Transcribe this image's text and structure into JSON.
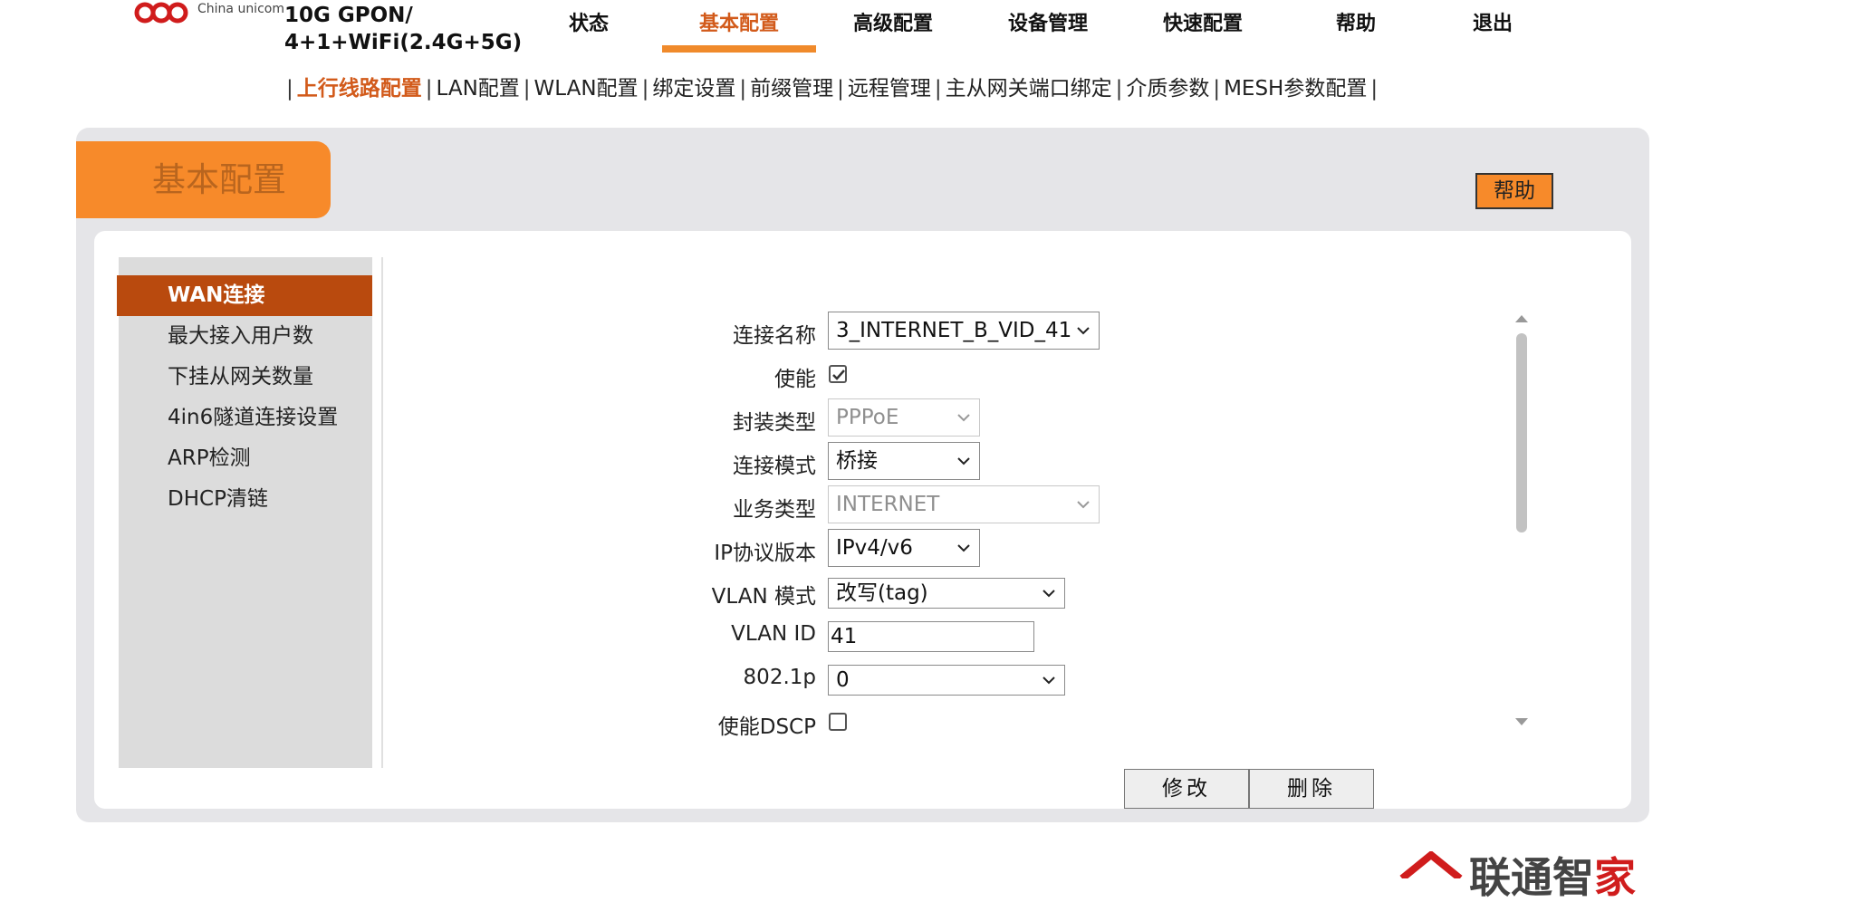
{
  "header": {
    "logo_text": "China unicom",
    "product_line1": "10G GPON/",
    "product_line2": "4+1+WiFi(2.4G+5G)",
    "nav": [
      {
        "label": "状态",
        "active": false
      },
      {
        "label": "基本配置",
        "active": true
      },
      {
        "label": "高级配置",
        "active": false
      },
      {
        "label": "设备管理",
        "active": false
      },
      {
        "label": "快速配置",
        "active": false
      },
      {
        "label": "帮助",
        "active": false
      },
      {
        "label": "退出",
        "active": false
      }
    ],
    "subnav": [
      {
        "label": "上行线路配置",
        "active": true
      },
      {
        "label": "LAN配置",
        "active": false
      },
      {
        "label": "WLAN配置",
        "active": false
      },
      {
        "label": "绑定设置",
        "active": false
      },
      {
        "label": "前缀管理",
        "active": false
      },
      {
        "label": "远程管理",
        "active": false
      },
      {
        "label": "主从网关端口绑定",
        "active": false
      },
      {
        "label": "介质参数",
        "active": false
      },
      {
        "label": "MESH参数配置",
        "active": false
      }
    ],
    "subnav_separator": "|"
  },
  "panel": {
    "title": "基本配置",
    "help_label": "帮助"
  },
  "sidebar": {
    "items": [
      {
        "label": "WAN连接",
        "active": true
      },
      {
        "label": "最大接入用户数",
        "active": false
      },
      {
        "label": "下挂从网关数量",
        "active": false
      },
      {
        "label": "4in6隧道连接设置",
        "active": false
      },
      {
        "label": "ARP检测",
        "active": false
      },
      {
        "label": "DHCP清链",
        "active": false
      }
    ]
  },
  "form": {
    "connection_name": {
      "label": "连接名称",
      "value": "3_INTERNET_B_VID_41"
    },
    "enable": {
      "label": "使能",
      "checked": true
    },
    "encap_type": {
      "label": "封装类型",
      "value": "PPPoE",
      "disabled": true
    },
    "conn_mode": {
      "label": "连接模式",
      "value": "桥接"
    },
    "service_type": {
      "label": "业务类型",
      "value": "INTERNET",
      "disabled": true
    },
    "ip_version": {
      "label": "IP协议版本",
      "value": "IPv4/v6"
    },
    "vlan_mode": {
      "label": "VLAN 模式",
      "value": "改写(tag)"
    },
    "vlan_id": {
      "label": "VLAN ID",
      "value": "41"
    },
    "dot1p": {
      "label": "802.1p",
      "value": "0"
    },
    "enable_dscp": {
      "label": "使能DSCP",
      "checked": false
    }
  },
  "actions": {
    "modify_label": "修改",
    "delete_label": "删除"
  },
  "footer": {
    "brand_text": "联通智",
    "brand_accent": "家"
  },
  "colors": {
    "accent_orange": "#f78a2a",
    "active_red": "#b94a0e",
    "active_text": "#d25a1a"
  }
}
